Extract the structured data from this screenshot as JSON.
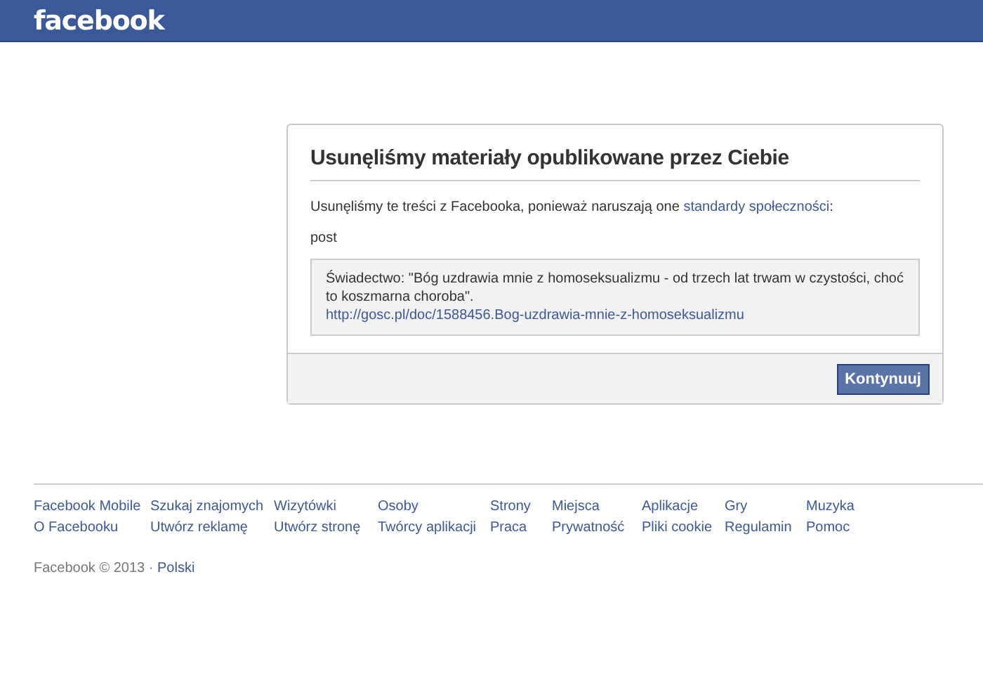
{
  "header": {
    "logo": "facebook"
  },
  "dialog": {
    "title": "Usunęliśmy materiały opublikowane przez Ciebie",
    "message": {
      "text": "Usunęliśmy te treści z Facebooka, ponieważ naruszają one ",
      "link": "standardy społeczności",
      "after": ":"
    },
    "content_type": "post",
    "quote": {
      "text": "Świadectwo: \"Bóg uzdrawia mnie z homoseksualizmu - od trzech lat trwam w czystości, choć to koszmarna choroba\".",
      "link": "http://gosc.pl/doc/1588456.Bog-uzdrawia-mnie-z-homoseksualizmu"
    },
    "button": "Kontynuuj"
  },
  "footer": {
    "links": [
      [
        "Facebook Mobile",
        "O Facebooku"
      ],
      [
        "Szukaj znajomych",
        "Utwórz reklamę"
      ],
      [
        "Wizytówki",
        "Utwórz stronę"
      ],
      [
        "Osoby",
        "Twórcy aplikacji"
      ],
      [
        "Strony",
        "Praca"
      ],
      [
        "Miejsca",
        "Prywatność"
      ],
      [
        "Aplikacje",
        "Pliki cookie"
      ],
      [
        "Gry",
        "Regulamin"
      ],
      [
        "Muzyka",
        "Pomoc"
      ]
    ],
    "copyright": "Facebook © 2013 ·",
    "language": "Polski"
  }
}
